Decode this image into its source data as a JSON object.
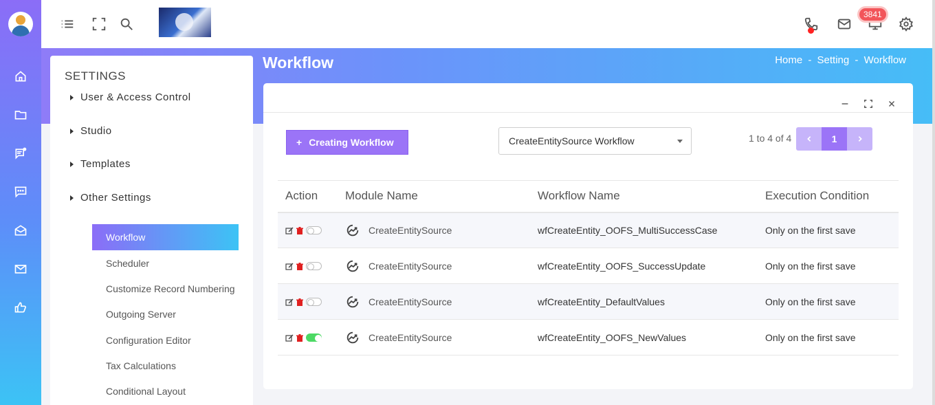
{
  "topbar": {
    "notification_count": "3841"
  },
  "header": {
    "title": "Workflow",
    "breadcrumb": [
      "Home",
      "Setting",
      "Workflow"
    ],
    "breadcrumb_sep": "-"
  },
  "settings": {
    "title": "SETTINGS",
    "categories": [
      "User & Access Control",
      "Studio",
      "Templates",
      "Other Settings"
    ],
    "items": [
      "Workflow",
      "Scheduler",
      "Customize Record Numbering",
      "Outgoing Server",
      "Configuration Editor",
      "Tax Calculations",
      "Conditional Layout"
    ],
    "active_item": "Workflow"
  },
  "toolbar": {
    "create_label": "Creating Workflow",
    "select_value": "CreateEntitySource Workflow",
    "pager_info": "1 to 4 of 4",
    "current_page": "1"
  },
  "table": {
    "columns": [
      "Action",
      "Module Name",
      "Workflow Name",
      "Execution Condition"
    ],
    "rows": [
      {
        "module": "CreateEntitySource",
        "workflow": "wfCreateEntity_OOFS_MultiSuccessCase",
        "condition": "Only on the first save",
        "enabled": false
      },
      {
        "module": "CreateEntitySource",
        "workflow": "wfCreateEntity_OOFS_SuccessUpdate",
        "condition": "Only on the first save",
        "enabled": false
      },
      {
        "module": "CreateEntitySource",
        "workflow": "wfCreateEntity_DefaultValues",
        "condition": "Only on the first save",
        "enabled": false
      },
      {
        "module": "CreateEntitySource",
        "workflow": "wfCreateEntity_OOFS_NewValues",
        "condition": "Only on the first save",
        "enabled": true
      }
    ]
  },
  "colors": {
    "accent": "#9b74f7",
    "accent_light": "#c6b4fa",
    "cyan": "#3cc3f5",
    "delete": "#e02020",
    "toggle_on": "#4cd964",
    "badge": "#f2555a"
  },
  "icons": {
    "rail": [
      "home-icon",
      "folder-icon",
      "notes-icon",
      "chat-icon",
      "mail-open-icon",
      "mail-icon",
      "thumbs-up-icon"
    ],
    "topbar": [
      "menu-icon",
      "fullscreen-icon",
      "search-icon",
      "phone-icon",
      "mail-icon",
      "monitor-icon",
      "gear-icon"
    ]
  }
}
